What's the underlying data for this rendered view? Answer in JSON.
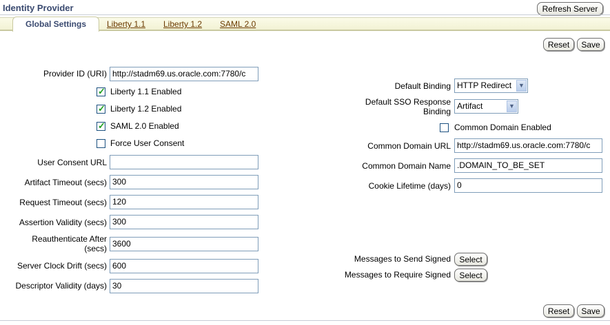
{
  "header": {
    "title": "Identity Provider",
    "refresh_label": "Refresh Server"
  },
  "tabs": [
    {
      "label": "Global Settings",
      "selected": true
    },
    {
      "label": "Liberty 1.1"
    },
    {
      "label": "Liberty 1.2"
    },
    {
      "label": "SAML 2.0"
    }
  ],
  "actions": {
    "reset": "Reset",
    "save": "Save"
  },
  "left": {
    "provider_id": {
      "label": "Provider ID (URI)",
      "value": "http://stadm69.us.oracle.com:7780/c"
    },
    "liberty11": {
      "label": "Liberty 1.1 Enabled",
      "checked": true
    },
    "liberty12": {
      "label": "Liberty 1.2 Enabled",
      "checked": true
    },
    "saml20": {
      "label": "SAML 2.0 Enabled",
      "checked": true
    },
    "force_consent": {
      "label": "Force User Consent",
      "checked": false
    },
    "user_consent_url": {
      "label": "User Consent URL",
      "value": ""
    },
    "artifact_timeout": {
      "label": "Artifact Timeout (secs)",
      "value": "300"
    },
    "request_timeout": {
      "label": "Request Timeout (secs)",
      "value": "120"
    },
    "assertion_validity": {
      "label": "Assertion Validity (secs)",
      "value": "300"
    },
    "reauth_line1": "Reauthenticate After",
    "reauth_line2": "(secs)",
    "reauth_value": "3600",
    "clock_drift": {
      "label": "Server Clock Drift (secs)",
      "value": "600"
    },
    "descriptor_validity": {
      "label": "Descriptor Validity (days)",
      "value": "30"
    }
  },
  "right": {
    "default_binding": {
      "label": "Default Binding",
      "value": "HTTP Redirect"
    },
    "sso_binding_line1": "Default SSO Response",
    "sso_binding_line2": "Binding",
    "sso_binding_value": "Artifact",
    "common_domain_enabled": {
      "label": "Common Domain Enabled",
      "checked": false
    },
    "common_domain_url": {
      "label": "Common Domain URL",
      "value": "http://stadm69.us.oracle.com:7780/c"
    },
    "common_domain_name": {
      "label": "Common Domain Name",
      "value": ".DOMAIN_TO_BE_SET"
    },
    "cookie_lifetime": {
      "label": "Cookie Lifetime (days)",
      "value": "0"
    },
    "send_signed": {
      "label": "Messages to Send Signed",
      "button": "Select"
    },
    "require_signed": {
      "label": "Messages to Require Signed",
      "button": "Select"
    }
  }
}
